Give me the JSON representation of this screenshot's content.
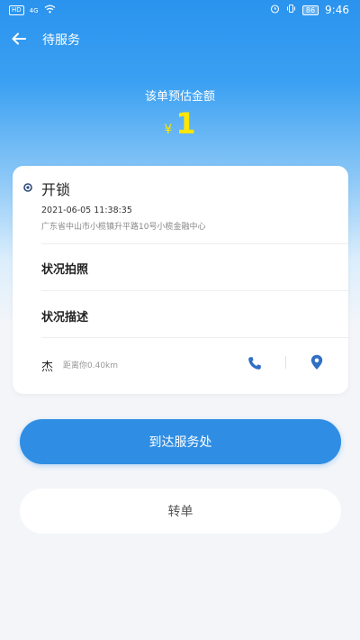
{
  "status_bar": {
    "left_badge": "HD",
    "signal_text": "4G",
    "battery": "86",
    "time": "9:46"
  },
  "nav": {
    "title": "待服务"
  },
  "estimate": {
    "label": "该单预估金额",
    "currency": "¥",
    "amount": "1"
  },
  "order": {
    "service_name": "开锁",
    "time": "2021-06-05 11:38:35",
    "address": "广东省中山市小榄镇升平路10号小榄金融中心",
    "photo_label": "状况拍照",
    "description_label": "状况描述",
    "customer_name": "杰",
    "distance": "距离你0.40km"
  },
  "actions": {
    "arrive_label": "到达服务处",
    "transfer_label": "转单"
  },
  "colors": {
    "primary": "#2f8ee4",
    "amount": "#ffe600"
  },
  "icons": {
    "back": "back-arrow-icon",
    "phone": "phone-icon",
    "location": "location-pin-icon"
  }
}
